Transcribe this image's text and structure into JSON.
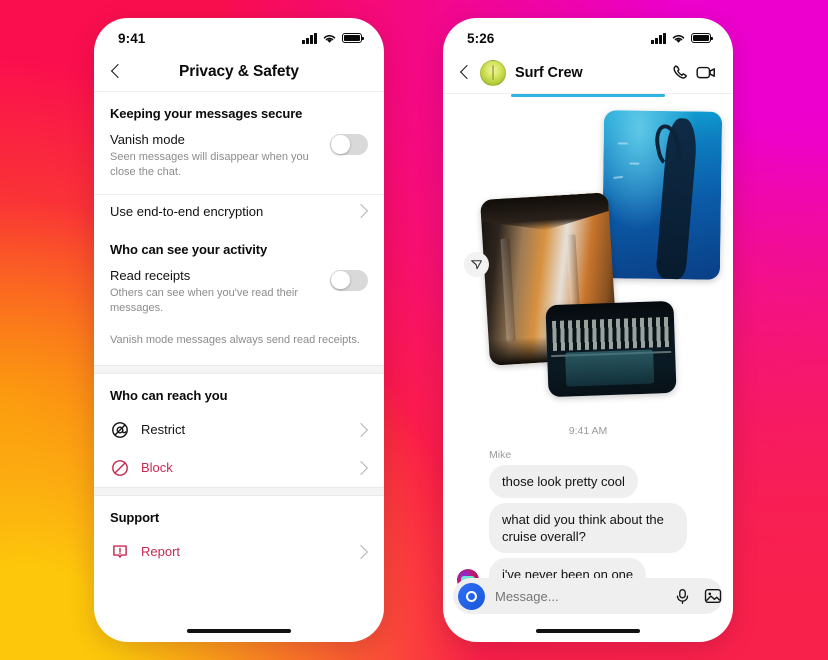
{
  "background": {
    "gradient_colors": [
      "#FDC70B",
      "#FA6B12",
      "#F8214C",
      "#FB0E4E",
      "#ED00CE"
    ]
  },
  "left_phone": {
    "status": {
      "time": "9:41",
      "cellular_icon": "signal-bars-icon",
      "wifi_icon": "wifi-icon",
      "battery_icon": "battery-icon"
    },
    "nav": {
      "back_icon": "chevron-left-icon",
      "title": "Privacy & Safety"
    },
    "sections": [
      {
        "heading": "Keeping your messages secure",
        "rows": [
          {
            "type": "toggle",
            "title": "Vanish mode",
            "subtitle": "Seen messages will disappear when you close the chat.",
            "state": "off"
          },
          {
            "type": "link",
            "title": "Use end-to-end encryption",
            "chevron": "chevron-right-icon"
          }
        ]
      },
      {
        "heading": "Who can see your activity",
        "rows": [
          {
            "type": "toggle",
            "title": "Read receipts",
            "subtitle": "Others can see when you've read their messages.",
            "state": "off"
          }
        ],
        "note": "Vanish mode messages always send read receipts."
      },
      {
        "heading": "Who can reach you",
        "rows": [
          {
            "type": "link",
            "title": "Restrict",
            "icon": "restrict-icon",
            "chevron": "chevron-right-icon",
            "color": "#141414"
          },
          {
            "type": "link",
            "title": "Block",
            "icon": "block-icon",
            "chevron": "chevron-right-icon",
            "color": "#C42A52"
          }
        ]
      },
      {
        "heading": "Support",
        "rows": [
          {
            "type": "link",
            "title": "Report",
            "icon": "report-icon",
            "chevron": "chevron-right-icon",
            "color": "#C42A52"
          }
        ]
      }
    ]
  },
  "right_phone": {
    "status": {
      "time": "5:26",
      "cellular_icon": "signal-bars-icon",
      "wifi_icon": "wifi-icon",
      "battery_icon": "battery-icon"
    },
    "nav": {
      "back_icon": "chevron-left-icon",
      "avatar": "group-avatar",
      "title": "Surf Crew",
      "call_icon": "phone-call-icon",
      "video_icon": "video-camera-icon",
      "accent_rule_color": "#2FB3E0"
    },
    "attachment": {
      "share_icon": "share-arrow-icon",
      "photos": [
        "underwater-diver-photo",
        "ship-interior-hall-photo",
        "ship-deck-pool-photo"
      ]
    },
    "timestamp": "9:41 AM",
    "sender_name": "Mike",
    "messages": [
      {
        "text": "those look pretty cool",
        "has_avatar": false
      },
      {
        "text": "what did you think about the cruise overall?",
        "has_avatar": false
      },
      {
        "text": "i've never been on one",
        "has_avatar": true
      }
    ],
    "composer": {
      "camera_icon": "instagram-camera-icon",
      "placeholder": "Message...",
      "value": "",
      "mic_icon": "microphone-icon",
      "gallery_icon": "photo-gallery-icon",
      "plus_icon": "plus-circle-icon"
    }
  }
}
